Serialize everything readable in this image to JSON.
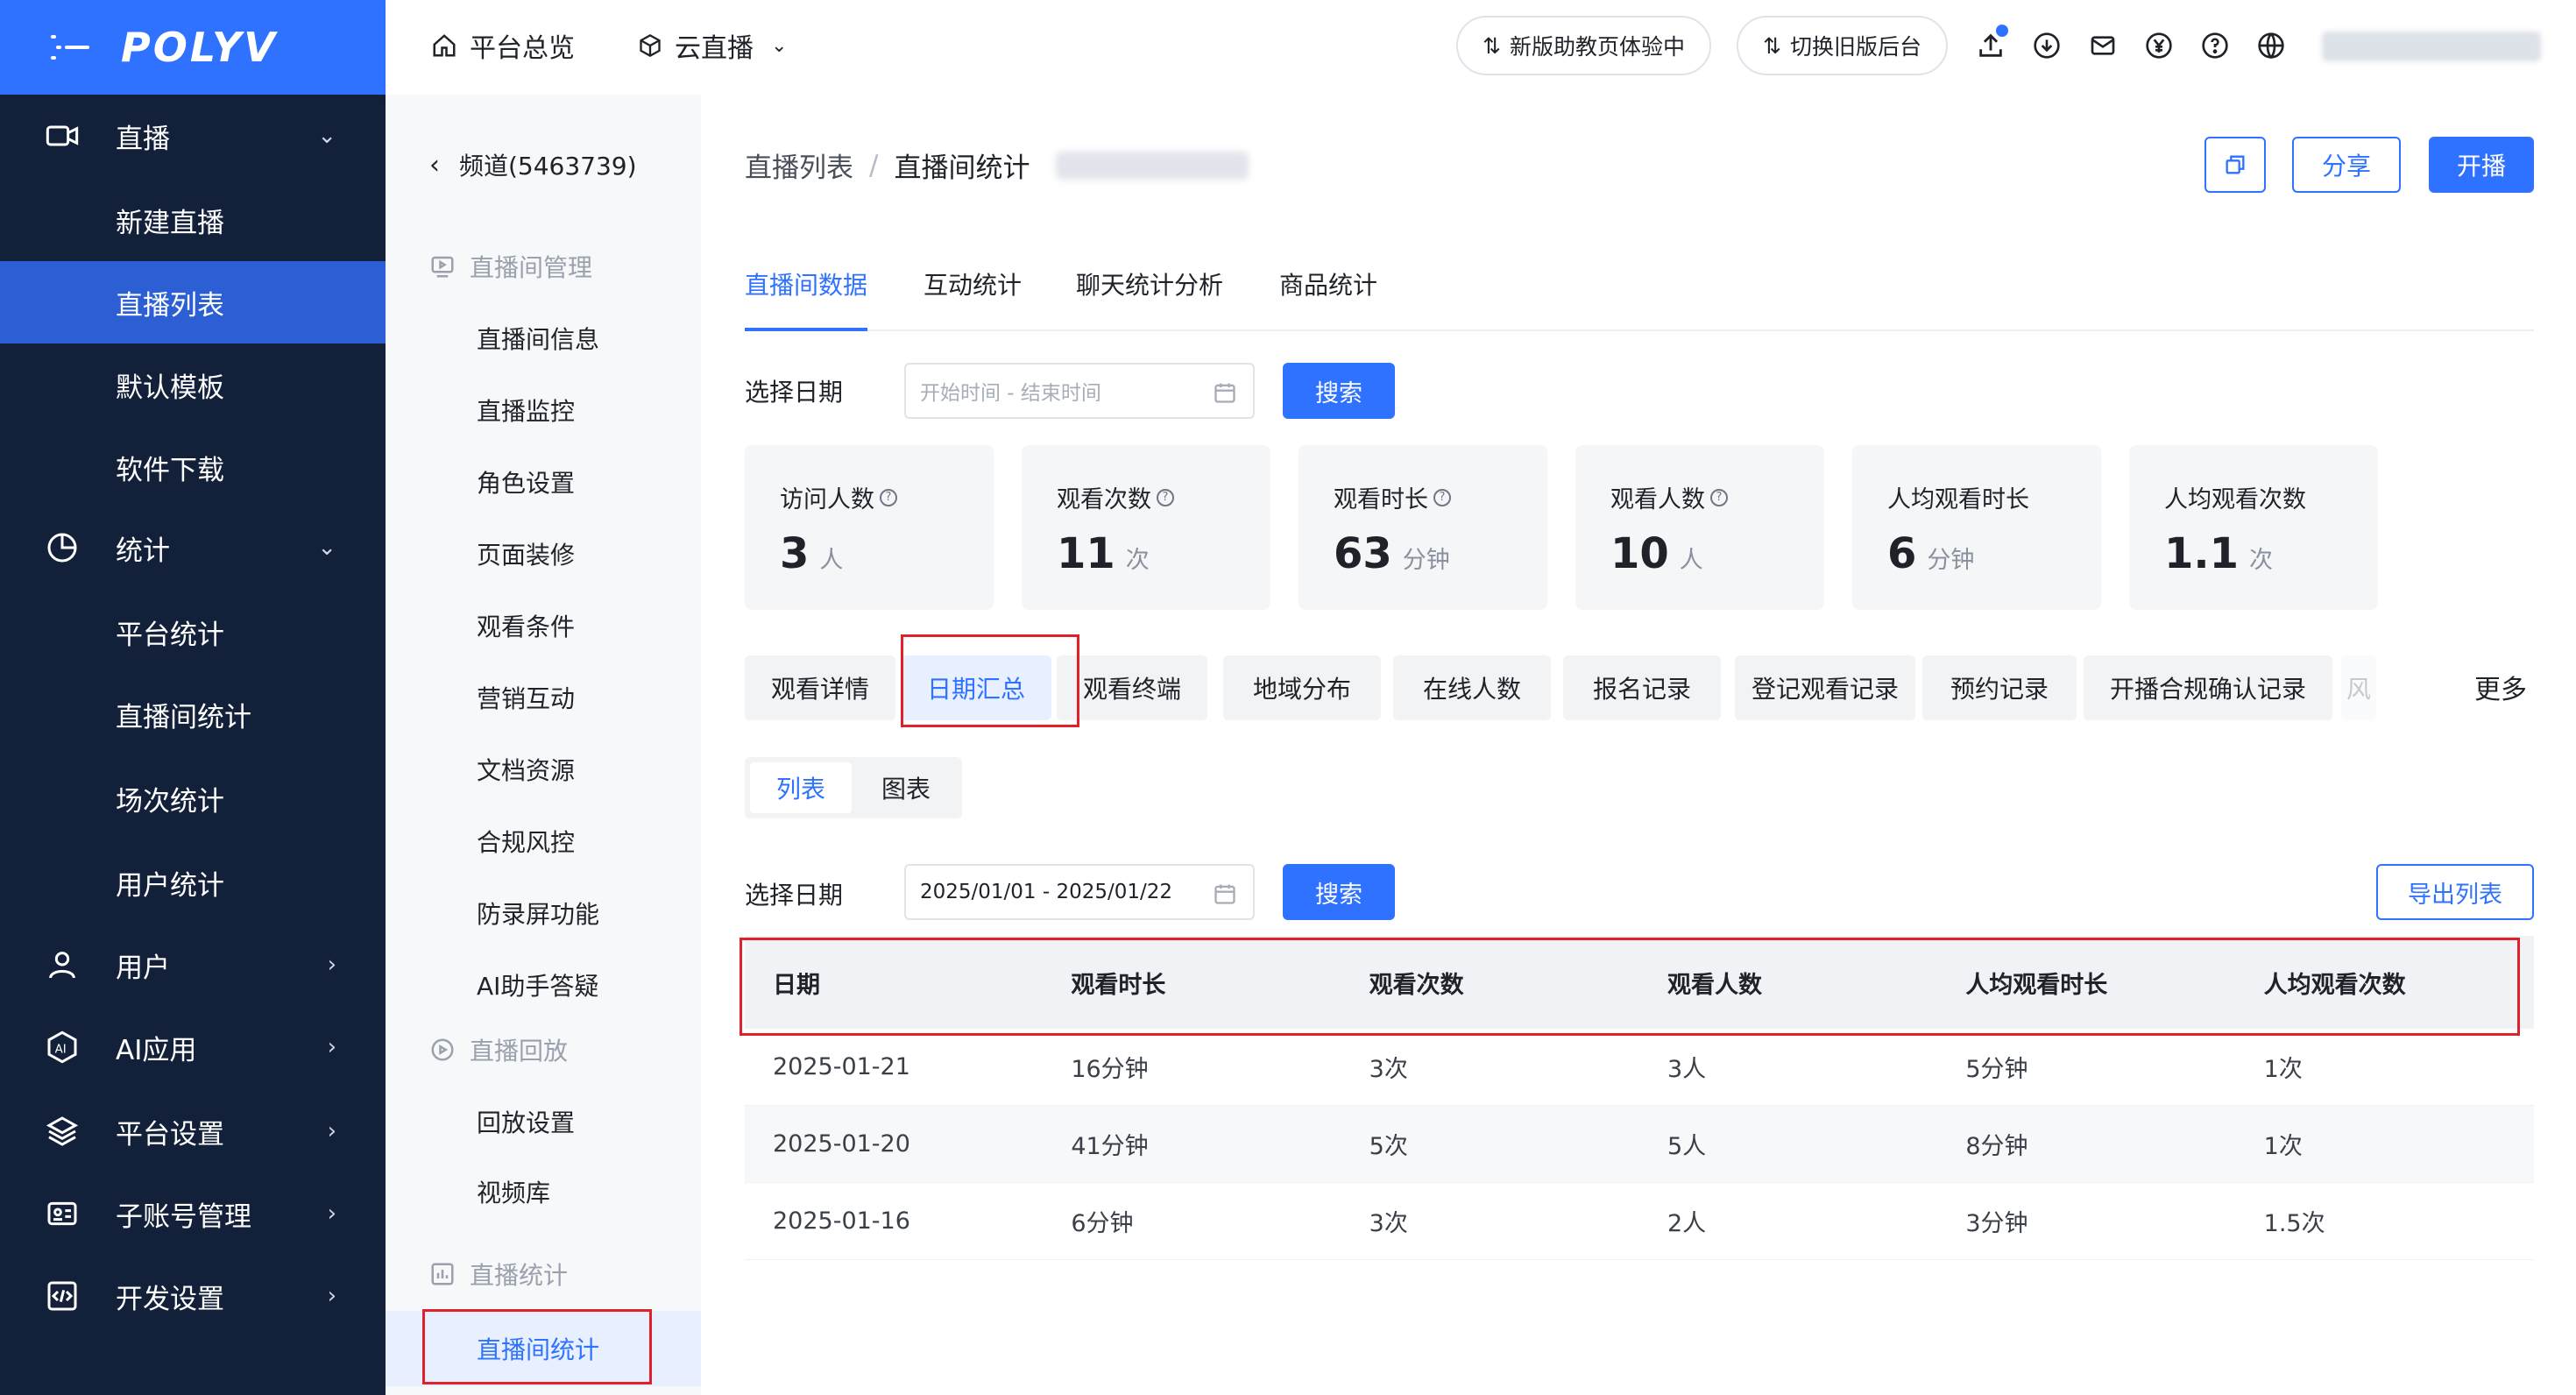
{
  "brand": {
    "logo": "POLYV"
  },
  "sidebar": {
    "items": [
      {
        "label": "直播",
        "icon": "video-camera-icon",
        "arrow": "⌄",
        "kind": "group"
      },
      {
        "label": "新建直播",
        "kind": "sub"
      },
      {
        "label": "直播列表",
        "kind": "sub",
        "active": true
      },
      {
        "label": "默认模板",
        "kind": "sub"
      },
      {
        "label": "软件下载",
        "kind": "sub"
      },
      {
        "label": "统计",
        "icon": "pie-chart-icon",
        "arrow": "⌄",
        "kind": "group"
      },
      {
        "label": "平台统计",
        "kind": "sub"
      },
      {
        "label": "直播间统计",
        "kind": "sub"
      },
      {
        "label": "场次统计",
        "kind": "sub"
      },
      {
        "label": "用户统计",
        "kind": "sub"
      },
      {
        "label": "用户",
        "icon": "user-icon",
        "arrow": "›",
        "kind": "group"
      },
      {
        "label": "AI应用",
        "icon": "ai-icon",
        "arrow": "›",
        "kind": "group"
      },
      {
        "label": "平台设置",
        "icon": "layers-icon",
        "arrow": "›",
        "kind": "group"
      },
      {
        "label": "子账号管理",
        "icon": "id-card-icon",
        "arrow": "›",
        "kind": "group"
      },
      {
        "label": "开发设置",
        "icon": "code-icon",
        "arrow": "›",
        "kind": "group"
      }
    ]
  },
  "topbar": {
    "home": "平台总览",
    "live": "云直播",
    "pill_new": "新版助教页体验中",
    "pill_old": "切换旧版后台"
  },
  "panel": {
    "back": "频道(5463739)",
    "group1": "直播间管理",
    "items1": [
      "直播间信息",
      "直播监控",
      "角色设置",
      "页面装修",
      "观看条件",
      "营销互动",
      "文档资源",
      "合规风控",
      "防录屏功能",
      "AI助手答疑"
    ],
    "group2": "直播回放",
    "items2": [
      "回放设置",
      "视频库"
    ],
    "group3": "直播统计",
    "active": "直播间统计"
  },
  "main": {
    "crumb1": "直播列表",
    "crumb_sep": "/",
    "crumb2": "直播间统计",
    "share": "分享",
    "start": "开播",
    "tabs": [
      "直播间数据",
      "互动统计",
      "聊天统计分析",
      "商品统计"
    ],
    "date_label": "选择日期",
    "date_placeholder": "开始时间 - 结束时间",
    "search": "搜索",
    "stats": [
      {
        "title": "访问人数",
        "value": "3",
        "unit": "人",
        "help": true
      },
      {
        "title": "观看次数",
        "value": "11",
        "unit": "次",
        "help": true
      },
      {
        "title": "观看时长",
        "value": "63",
        "unit": "分钟",
        "help": true
      },
      {
        "title": "观看人数",
        "value": "10",
        "unit": "人",
        "help": true
      },
      {
        "title": "人均观看时长",
        "value": "6",
        "unit": "分钟",
        "help": false
      },
      {
        "title": "人均观看次数",
        "value": "1.1",
        "unit": "次",
        "help": false
      }
    ],
    "subtabs": [
      "观看详情",
      "日期汇总",
      "观看终端",
      "地域分布",
      "在线人数",
      "报名记录",
      "登记观看记录",
      "预约记录",
      "开播合规确认记录",
      "风"
    ],
    "more": "更多",
    "view_list": "列表",
    "view_chart": "图表",
    "date_label2": "选择日期",
    "date_value": "2025/01/01 - 2025/01/22",
    "search2": "搜索",
    "export": "导出列表",
    "table": {
      "headers": [
        "日期",
        "观看时长",
        "观看次数",
        "观看人数",
        "人均观看时长",
        "人均观看次数"
      ],
      "rows": [
        [
          "2025-01-21",
          "16分钟",
          "3次",
          "3人",
          "5分钟",
          "1次"
        ],
        [
          "2025-01-20",
          "41分钟",
          "5次",
          "5人",
          "8分钟",
          "1次"
        ],
        [
          "2025-01-16",
          "6分钟",
          "3次",
          "2人",
          "3分钟",
          "1.5次"
        ]
      ]
    }
  },
  "colors": {
    "accent": "#2f72ff",
    "sidebar": "#13203a",
    "highlight": "#e0202a"
  }
}
